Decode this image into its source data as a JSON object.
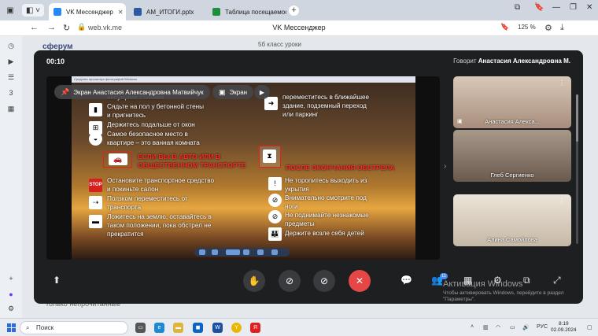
{
  "browser": {
    "tabs": [
      {
        "label": "VK Мессенджер",
        "active": true,
        "favicon_color": "#2787f5"
      },
      {
        "label": "АМ_ИТОГИ.pptx",
        "active": false,
        "favicon_color": "#2c5aa0"
      },
      {
        "label": "Таблица посещаемости",
        "active": false,
        "favicon_color": "#1e8e3e"
      }
    ],
    "address": {
      "url": "web.vk.me",
      "page_title": "VK Мессенджер",
      "zoom": "125 %"
    }
  },
  "background_page": {
    "brand": "сферум",
    "chat_name": "5б класс уроки",
    "bottom_text": "только непрочитанные"
  },
  "call": {
    "timer": "00:10",
    "speaking_prefix": "Говорит",
    "speaking_name": "Анастасия Александровна М.",
    "screen_chip": "Экран Анастасия Александровна Матвийчук",
    "screen_chip2": "Экран",
    "participants": [
      {
        "name": "Анастасия Алекса...",
        "bg": "#c8b7a8"
      },
      {
        "name": "Глеб Сергиенко",
        "bg": "#8a7a6a"
      },
      {
        "name": "Алина Самойлова",
        "bg": "#d9d0c4"
      }
    ],
    "participant_count_badge": "11",
    "activate_title": "Активация Windows",
    "activate_text": "Чтобы активировать Windows, перейдите в раздел \"Параметры\"."
  },
  "slide": {
    "window_caption": "Средство просмотра фотографий Windows",
    "left_lines": [
      "несущими стенами",
      "Сядьте на пол у бетонной стены",
      "и пригнитесь",
      "Держитесь подальше от окон",
      "Самое безопасное место в",
      "квартире – это ванная комната"
    ],
    "left_heading1": "ЕСЛИ ВЫ В АВТО ИЛИ В",
    "left_heading2": "ОБЩЕСТВЕННОМ ТРАНСПОРТЕ",
    "left_lines2": [
      "Остановите транспортное средство",
      "и покиньте салон",
      "Ползком переместитесь от",
      "транспорта",
      "Ложитесь на землю, оставайтесь в",
      "таком положении, пока обстрел не",
      "прекратится"
    ],
    "right_top_lines": [
      "переместитесь в ближайшее",
      "здание, подземный переход",
      "или паркинг"
    ],
    "right_heading": "ПОСЛЕ ОКОНЧАНИЯ ОБСТРЕЛА",
    "right_lines": [
      "Не торопитесь выходить из",
      "укрытия",
      "Внимательно смотрите  под",
      "ноги",
      "Не поднимайте незнакомые",
      "предметы",
      "Держите возле себя детей"
    ],
    "stop_sign": "STOP"
  },
  "taskbar": {
    "search_placeholder": "Поиск",
    "lang": "РУС",
    "time": "8:19",
    "date": "02.09.2024"
  }
}
